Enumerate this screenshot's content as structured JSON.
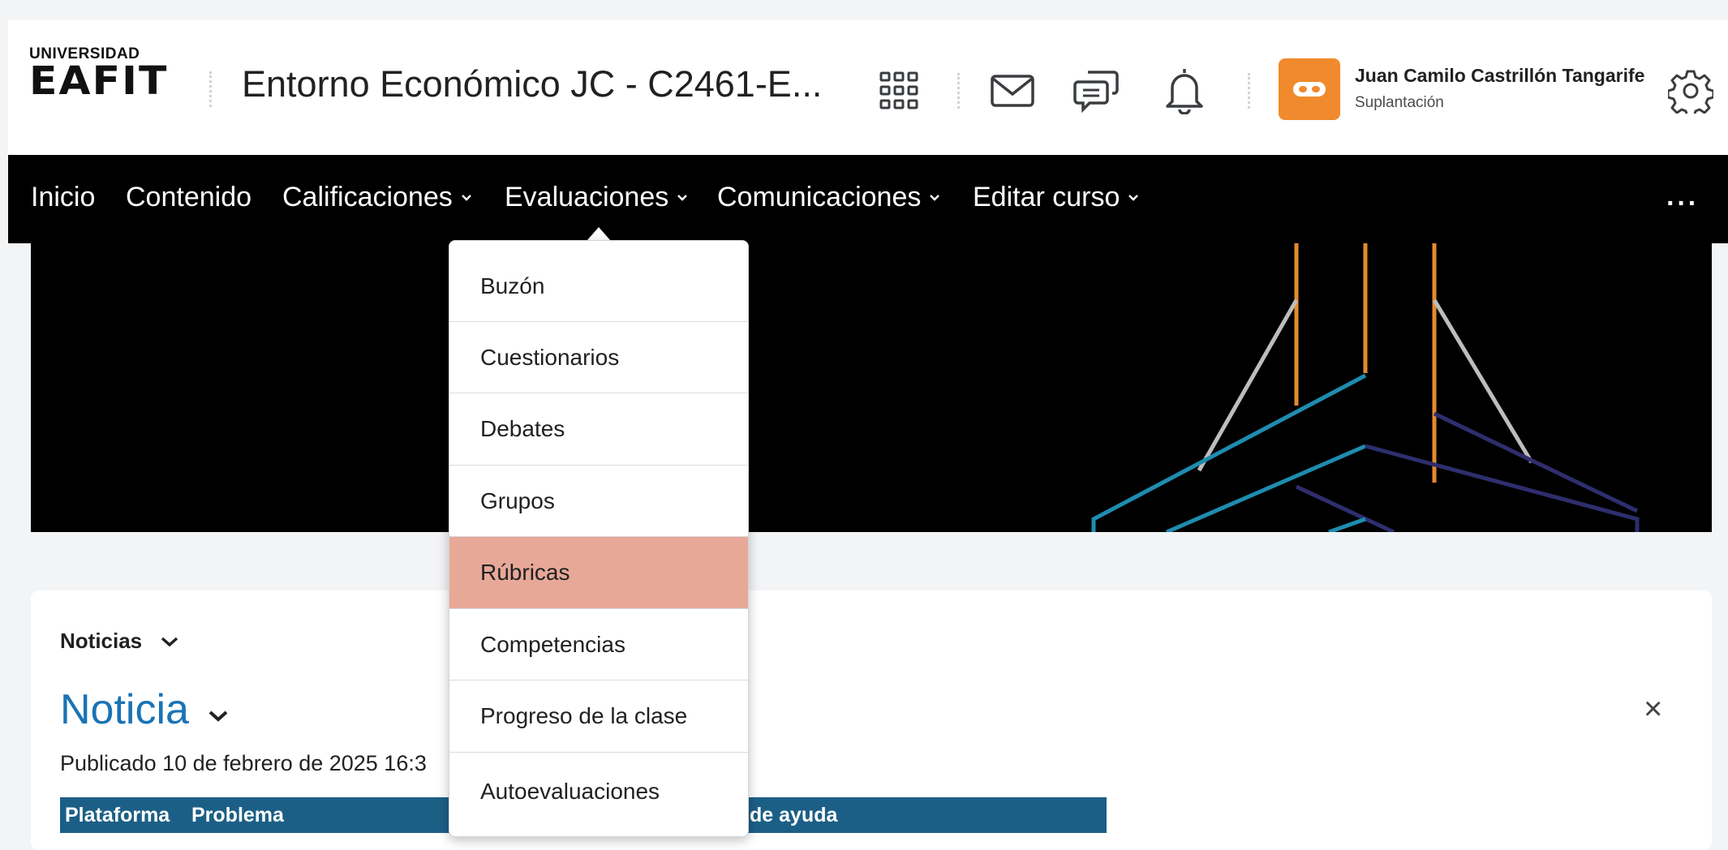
{
  "header": {
    "logo": {
      "line1": "UNIVERSIDAD",
      "line2": "EAFIT"
    },
    "course_title": "Entorno Económico JC - C2461-E...",
    "icons": [
      "grid-icon",
      "mail-icon",
      "chat-icon",
      "bell-icon",
      "gear-icon"
    ],
    "user": {
      "name": "Juan Camilo Castrillón Tangarife",
      "role": "Suplantación",
      "avatar_color": "#f08a2c"
    }
  },
  "nav": {
    "items": [
      {
        "label": "Inicio",
        "dropdown": false
      },
      {
        "label": "Contenido",
        "dropdown": false
      },
      {
        "label": "Calificaciones",
        "dropdown": true
      },
      {
        "label": "Evaluaciones",
        "dropdown": true
      },
      {
        "label": "Comunicaciones",
        "dropdown": true
      },
      {
        "label": "Editar curso",
        "dropdown": true
      }
    ],
    "more": "···"
  },
  "dropdown": {
    "items": [
      "Buzón",
      "Cuestionarios",
      "Debates",
      "Grupos",
      "Rúbricas",
      "Competencias",
      "Progreso de la clase",
      "Autoevaluaciones"
    ],
    "highlighted": "Rúbricas",
    "highlight_color": "#e8a898"
  },
  "content": {
    "widget_title": "Noticias",
    "news_title": "Noticia",
    "published": "Publicado 10 de febrero de 2025 16:3",
    "table_headers": [
      "Plataforma",
      "Problema",
      "de ayuda"
    ],
    "close": "×",
    "accent_color": "#1a73b5",
    "table_header_color": "#1c5f86"
  }
}
